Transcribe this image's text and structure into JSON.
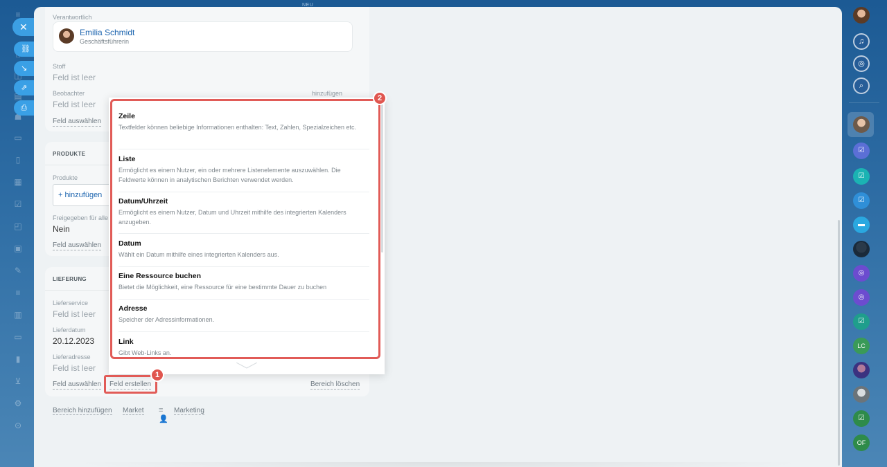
{
  "top_label": "NEU",
  "left_nav": {
    "close_icon": "close-icon",
    "quick_actions": [
      "link-icon",
      "download-icon",
      "external-link-icon",
      "print-icon"
    ]
  },
  "responsible": {
    "label": "Verantwortlich",
    "name": "Emilia Schmidt",
    "position": "Geschäftsführerin"
  },
  "fields_top": {
    "stoff_label": "Stoff",
    "stoff_value": "Feld ist leer",
    "beobachter_label": "Beobachter",
    "beobachter_add": "hinzufügen",
    "beobachter_value": "Feld ist leer",
    "select_field": "Feld auswählen"
  },
  "produkte": {
    "title": "PRODUKTE",
    "produkte_label": "Produkte",
    "add_button": "+ hinzufügen",
    "freigegeben_label": "Freigegeben für alle",
    "freigegeben_value": "Nein",
    "select_field": "Feld auswählen"
  },
  "lieferung": {
    "title": "LIEFERUNG",
    "lieferservice_label": "Lieferservice",
    "lieferservice_value": "Feld ist leer",
    "lieferdatum_label": "Lieferdatum",
    "lieferdatum_value": "20.12.2023",
    "lieferadresse_label": "Lieferadresse",
    "lieferadresse_value": "Feld ist leer",
    "select_field": "Feld auswählen",
    "create_field": "Feld erstellen",
    "delete_section": "Bereich löschen"
  },
  "bottom_links": {
    "add_section": "Bereich hinzufügen",
    "market": "Market",
    "marketing": "Marketing"
  },
  "menu": {
    "items": [
      {
        "title": "Zeile",
        "desc": "Textfelder können beliebige Informationen enthalten: Text, Zahlen, Spezialzeichen etc."
      },
      {
        "title": "Liste",
        "desc": "Ermöglicht es einem Nutzer, ein oder mehrere Listenelemente auszuwählen. Die Feldwerte können in analytischen Berichten verwendet werden."
      },
      {
        "title": "Datum/Uhrzeit",
        "desc": "Ermöglicht es einem Nutzer, Datum und Uhrzeit mithilfe des integrierten Kalenders anzugeben."
      },
      {
        "title": "Datum",
        "desc": "Wählt ein Datum mithilfe eines integrierten Kalenders aus."
      },
      {
        "title": "Eine Ressource buchen",
        "desc": "Bietet die Möglichkeit, eine Ressource für eine bestimmte Dauer zu buchen"
      },
      {
        "title": "Adresse",
        "desc": "Speicher der Adressinformationen."
      },
      {
        "title": "Link",
        "desc": "Gibt Web-Links an."
      }
    ]
  },
  "callouts": {
    "one": "1",
    "two": "2"
  },
  "right_bar": {
    "lc_initials": "LC",
    "of_initials": "OF"
  },
  "colors": {
    "accent": "#2067b0",
    "highlight": "#e15b57",
    "background": "#1f5f97"
  }
}
